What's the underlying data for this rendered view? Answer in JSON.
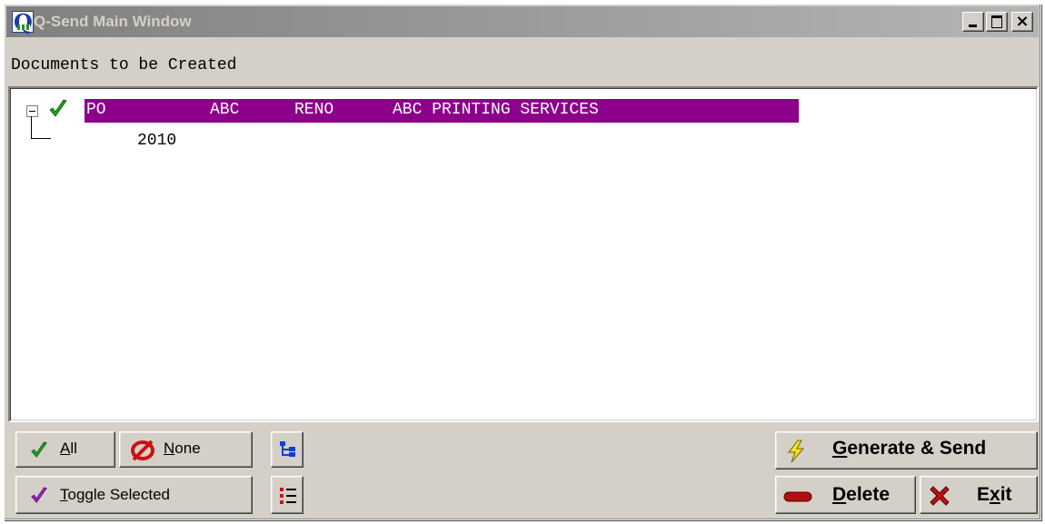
{
  "window": {
    "title": "Q-Send Main Window"
  },
  "section_label": "Documents to be Created",
  "tree": {
    "parent": {
      "cols": [
        "PO",
        "ABC",
        "RENO",
        "ABC PRINTING SERVICES"
      ],
      "checked": true
    },
    "child": {
      "label": "2010"
    }
  },
  "buttons": {
    "all": {
      "u": "A",
      "rest": "ll"
    },
    "none": {
      "u": "N",
      "rest": "one"
    },
    "toggle": {
      "u": "T",
      "rest": "oggle Selected"
    },
    "generate": {
      "u": "G",
      "rest": "enerate & Send"
    },
    "delete": {
      "u": "D",
      "rest": "elete"
    },
    "exit": {
      "pre": "E",
      "u": "x",
      "rest": "it"
    }
  },
  "colors": {
    "selection": "#8c008c",
    "face": "#d4d0c8",
    "check": "#1fa01f",
    "toggle_check": "#a020c0"
  }
}
